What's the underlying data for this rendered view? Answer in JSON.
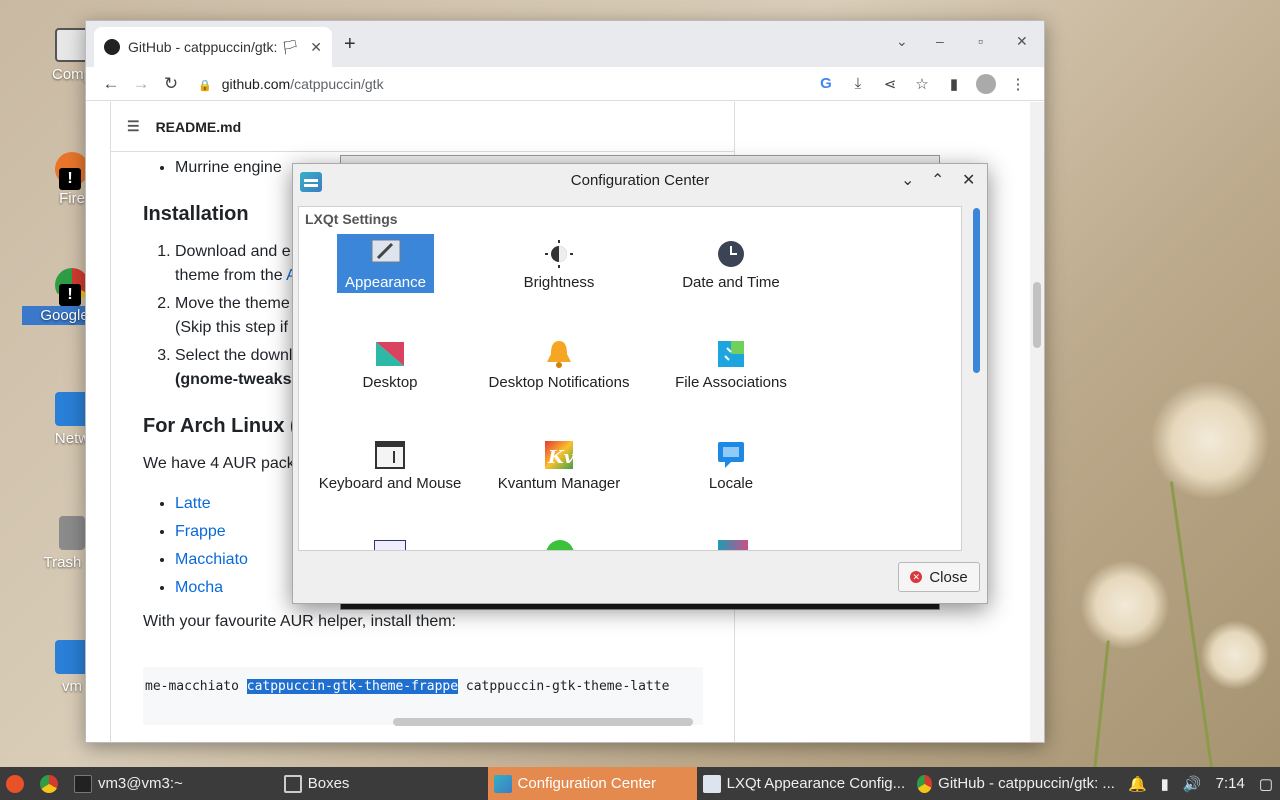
{
  "desktop": {
    "icons": [
      {
        "label": "Comp",
        "color": "#6e8a5a"
      },
      {
        "label": "Fire",
        "color": "#e8752a"
      },
      {
        "label": "Google C",
        "color": "#d33b2f"
      },
      {
        "label": "Netw",
        "color": "#2a7fd6"
      },
      {
        "label": "Trash (E",
        "color": "#8b8b8b"
      },
      {
        "label": "vm",
        "color": "#2a7fd6"
      }
    ]
  },
  "browser": {
    "tab_title": "GitHub - catppuccin/gtk: 🏳",
    "tab_close": "✕",
    "new_tab": "+",
    "url_host": "github.com",
    "url_path": "/catppuccin/gtk",
    "readme_title": "README.md",
    "content": {
      "bullet_top": "Murrine engine",
      "h_install": "Installation",
      "steps": [
        {
          "text": "Download and e",
          "text2": "theme from the ",
          "link": "A"
        },
        {
          "text": "Move the theme",
          "text2": "(Skip this step if"
        },
        {
          "text": "Select the downl",
          "bold": "(gnome-tweaks"
        }
      ],
      "h_arch": "For Arch Linux (",
      "aur_text": "We have 4 AUR pack",
      "aur_links": [
        "Latte",
        "Frappe",
        "Macchiato",
        "Mocha"
      ],
      "helper_text": "With your favourite AUR helper, install them:",
      "code_before": "me-macchiato ",
      "code_highlight": "catppuccin-gtk-theme-frappe",
      "code_after": " catppuccin-gtk-theme-latte"
    }
  },
  "dialog": {
    "title": "Configuration Center",
    "section": "LXQt Settings",
    "items": [
      {
        "label": "Appearance",
        "icon": "appearance-icon",
        "selected": true
      },
      {
        "label": "Brightness",
        "icon": "brightness-icon"
      },
      {
        "label": "Date and Time",
        "icon": "clock-icon"
      },
      {
        "label": "Desktop",
        "icon": "desktop-icon"
      },
      {
        "label": "Desktop Notifications",
        "icon": "bell-icon"
      },
      {
        "label": "File Associations",
        "icon": "file-associations-icon"
      },
      {
        "label": "Keyboard and Mouse",
        "icon": "keyboard-icon"
      },
      {
        "label": "Kvantum Manager",
        "icon": "kvantum-icon"
      },
      {
        "label": "Locale",
        "icon": "locale-icon"
      }
    ],
    "close_label": "Close"
  },
  "taskbar": {
    "tasks": [
      {
        "label": "vm3@vm3:~",
        "active": false
      },
      {
        "label": "Boxes",
        "active": false
      },
      {
        "label": "Configuration Center",
        "active": true
      },
      {
        "label": "LXQt Appearance Config...",
        "active": false
      },
      {
        "label": "GitHub - catppuccin/gtk: ...",
        "active": false
      }
    ],
    "clock": "7:14"
  }
}
